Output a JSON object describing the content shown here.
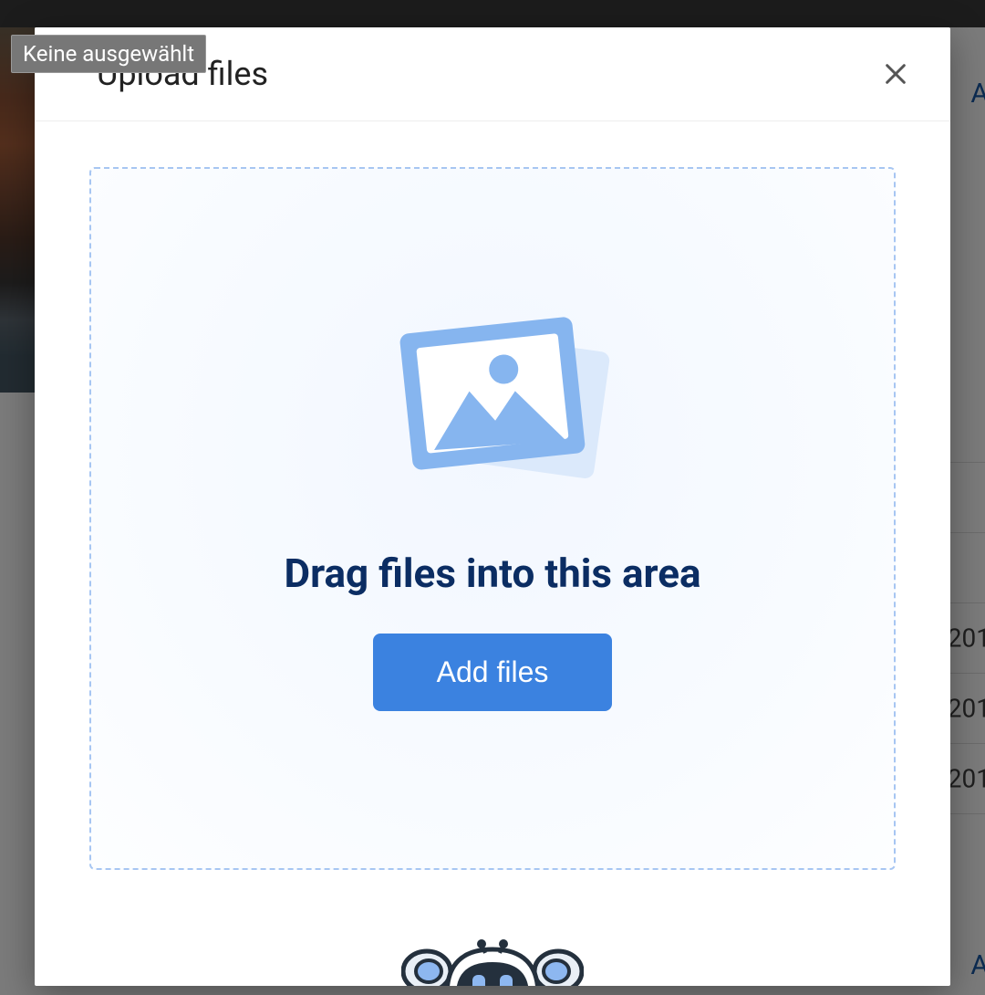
{
  "tooltip": {
    "text": "Keine ausgewählt"
  },
  "modal": {
    "title": "Upload files",
    "dropzone": {
      "instruction": "Drag files into this area",
      "button_label": "Add files"
    }
  },
  "background": {
    "top_link": "A",
    "rows": [
      "201",
      "201",
      "201"
    ],
    "bottom_link": "A"
  },
  "icons": {
    "close": "close-icon",
    "image_placeholder": "image-placeholder-icon",
    "robot": "robot-icon"
  },
  "colors": {
    "accent": "#3b82e0",
    "dropzone_border": "#a7c6f2",
    "heading": "#0b2d63"
  }
}
